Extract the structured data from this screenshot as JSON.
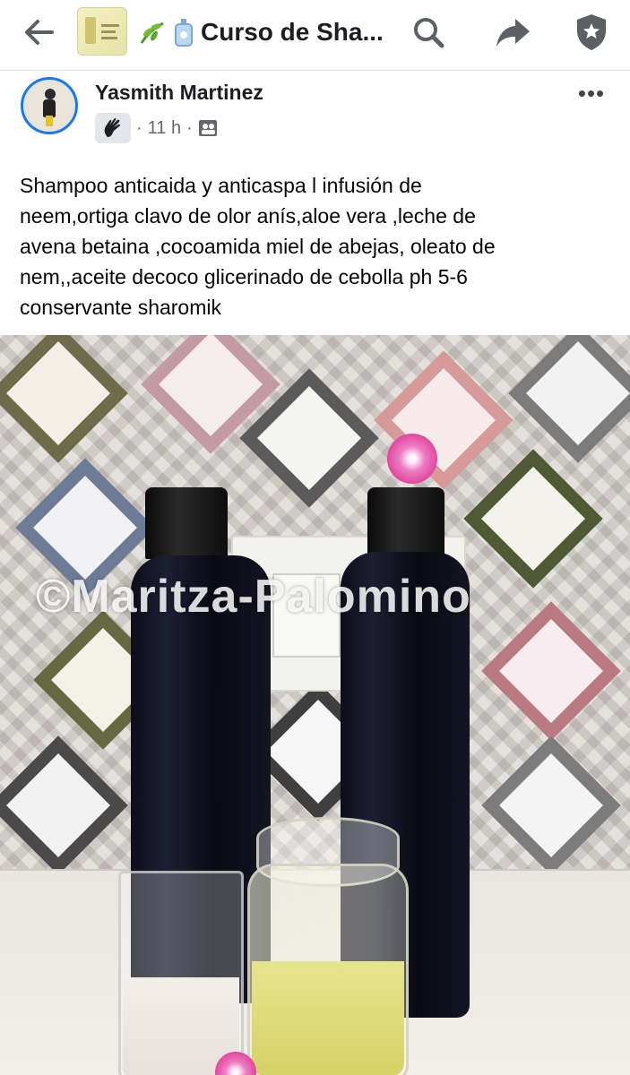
{
  "topbar": {
    "group_title": "Curso de Sha...",
    "icons": [
      "back-arrow-icon",
      "leaf-icon",
      "soap-bottle-icon",
      "search-icon",
      "share-icon",
      "shield-icon"
    ]
  },
  "post": {
    "author": "Yasmith Martinez",
    "time": "11 h",
    "separator": "·",
    "more_label": "•••",
    "text": "Shampoo  anticaida y anticaspa  l infusión  de\nneem,ortiga clavo  de olor anís,aloe  vera ,leche de\navena  betaina ,cocoamida  miel de abejas, oleato  de\nnem,,aceite decoco  glicerinado de  cebolla ph 5-6\nconservante  sharomik"
  },
  "photo": {
    "watermark": "©Maritza-Palomino",
    "description_icons": [
      "bottle",
      "flower",
      "glass",
      "jar"
    ]
  },
  "colors": {
    "accent": "#1877f2",
    "text": "#1c1e21",
    "muted": "#65676b",
    "icon": "#5c5f64"
  }
}
